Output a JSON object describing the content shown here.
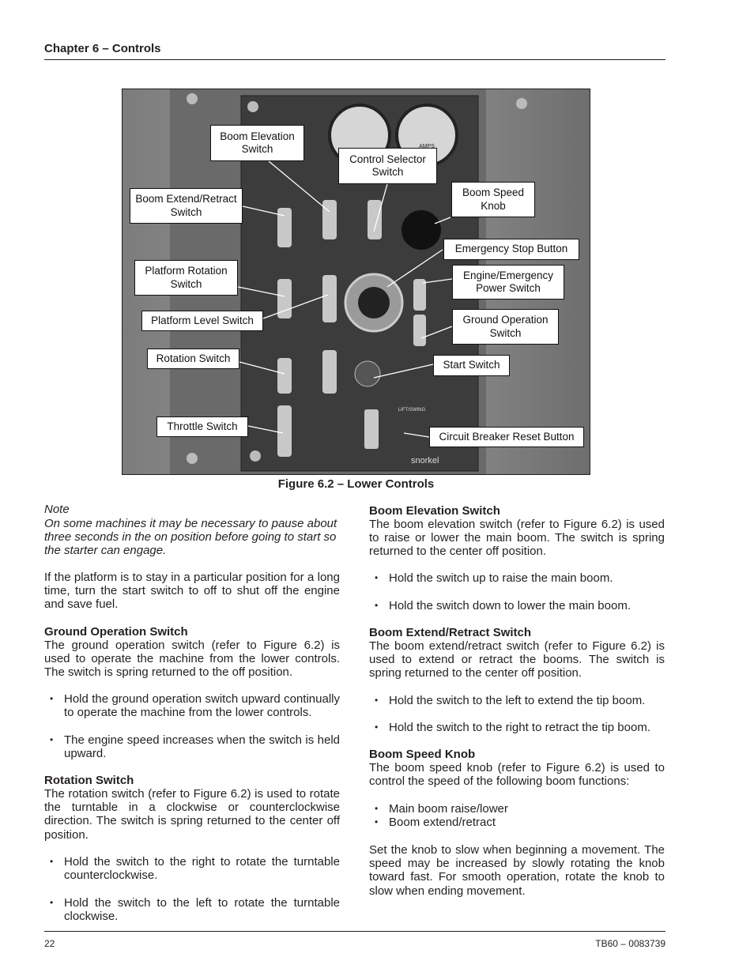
{
  "header": {
    "chapter": "Chapter 6 – Controls"
  },
  "figure": {
    "caption": "Figure 6.2 – Lower Controls",
    "labels": {
      "boom_elevation": "Boom Elevation Switch",
      "control_selector": "Control Selector Switch",
      "boom_speed": "Boom Speed Knob",
      "boom_extend": "Boom Extend/Retract Switch",
      "emergency_stop": "Emergency Stop Button",
      "engine_emergency": "Engine/Emergency Power Switch",
      "platform_rotation": "Platform Rotation Switch",
      "platform_level": "Platform Level Switch",
      "ground_operation": "Ground Operation Switch",
      "rotation": "Rotation Switch",
      "start": "Start Switch",
      "throttle": "Throttle Switch",
      "circuit_breaker": "Circuit Breaker Reset Button"
    },
    "panel_marks": {
      "gauge_unit": "AMPS",
      "brand": "snorkel",
      "lift_swing": "LIFT/SWING"
    }
  },
  "left": {
    "note_label": "Note",
    "note_text": "On some machines it may be necessary to pause about three seconds in the on position before going to start so the starter can engage.",
    "para1": "If the platform is to stay in a particular position for a long time, turn the start switch to off to shut off the engine and save fuel.",
    "ground_heading": "Ground Operation Switch",
    "ground_text": "The ground operation switch (refer to Figure 6.2) is used to operate the machine from the lower controls. The switch is spring returned to the off position.",
    "ground_bullets": [
      "Hold the ground operation switch upward continually to operate the machine from the lower controls.",
      "The engine speed increases when the switch is held upward."
    ],
    "rotation_heading": "Rotation Switch",
    "rotation_text": "The rotation switch (refer to Figure 6.2) is used to rotate the turntable in a clockwise or counterclockwise direction. The switch is spring returned to the center off position.",
    "rotation_bullets": [
      "Hold the switch to the right to rotate the turntable counterclockwise.",
      "Hold the switch to the left to rotate the turntable clockwise."
    ]
  },
  "right": {
    "elev_heading": "Boom Elevation Switch",
    "elev_text": "The boom elevation switch (refer to Figure 6.2) is used to raise or lower the main boom. The switch is spring returned to the center off position.",
    "elev_bullets": [
      "Hold the switch up to raise the main boom.",
      "Hold the switch down to lower the main boom."
    ],
    "extend_heading": "Boom Extend/Retract Switch",
    "extend_text": "The boom extend/retract switch (refer to Figure 6.2) is used to extend or retract the booms. The switch is spring returned to the center off position.",
    "extend_bullets": [
      "Hold the switch to the left to extend the tip boom.",
      "Hold the switch to the right to retract the tip boom."
    ],
    "speed_heading": "Boom Speed Knob",
    "speed_text": "The boom speed knob (refer to Figure 6.2) is used to control the speed of the following boom functions:",
    "speed_bullets": [
      "Main boom raise/lower",
      "Boom extend/retract"
    ],
    "speed_para": "Set the knob to slow when beginning a movement. The speed may be increased by slowly rotating the knob toward fast. For smooth operation, rotate the knob to slow when ending movement."
  },
  "footer": {
    "page": "22",
    "doc": "TB60 – 0083739"
  }
}
